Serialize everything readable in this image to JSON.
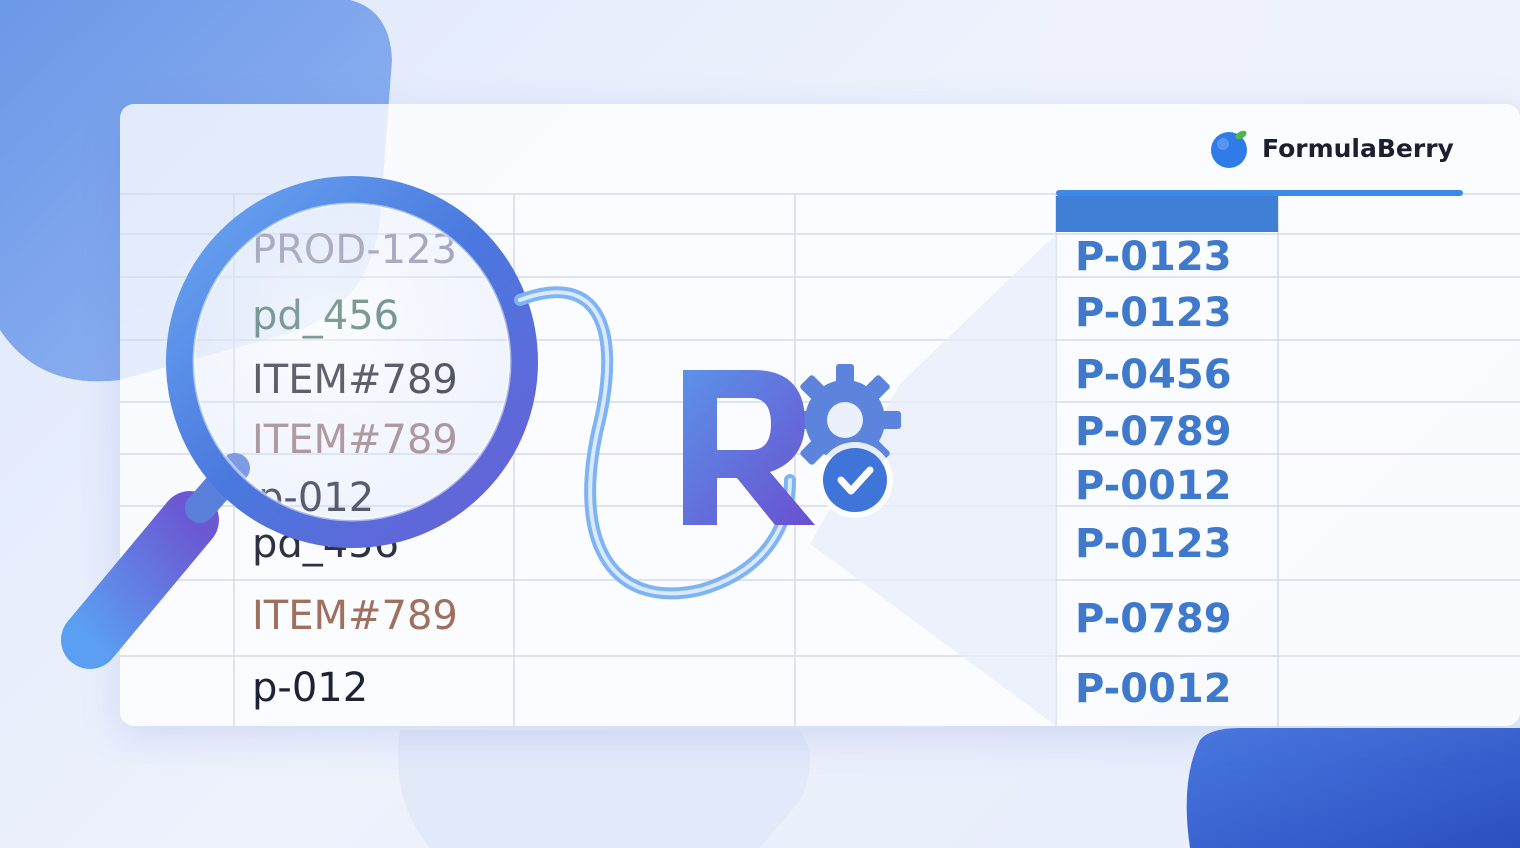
{
  "brand": {
    "name": "FormulaBerry",
    "logo_color": "#2f7be8",
    "leaf_color": "#49b84a"
  },
  "left_column": {
    "cells": [
      {
        "text": "PROD-123",
        "color": "#8f8aa8"
      },
      {
        "text": "pd_456",
        "color": "#3d6b62"
      },
      {
        "text": "ITEM#789",
        "color": "#1c1c28"
      },
      {
        "text": "ITEM#789",
        "color": "#9a7a78"
      },
      {
        "text": "p-012",
        "color": "#2a2a3a"
      },
      {
        "text": "pd_456",
        "color": "#2e3140"
      },
      {
        "text": "ITEM#789",
        "color": "#a0705e"
      },
      {
        "text": "p-012",
        "color": "#1e2236"
      }
    ]
  },
  "right_column": {
    "header_color": "#3f7fd6",
    "cells": [
      "P-0123",
      "P-0123",
      "P-0456",
      "P-0789",
      "P-0012",
      "P-0123",
      "P-0789",
      "P-0012"
    ]
  },
  "icons": {
    "magnifier": "magnifying-glass-icon",
    "r_logo": "r-language-logo-icon",
    "gear": "gear-icon",
    "check": "check-badge-icon"
  },
  "colors": {
    "accent": "#3f79cc",
    "grid_line": "#cfd8ea"
  }
}
